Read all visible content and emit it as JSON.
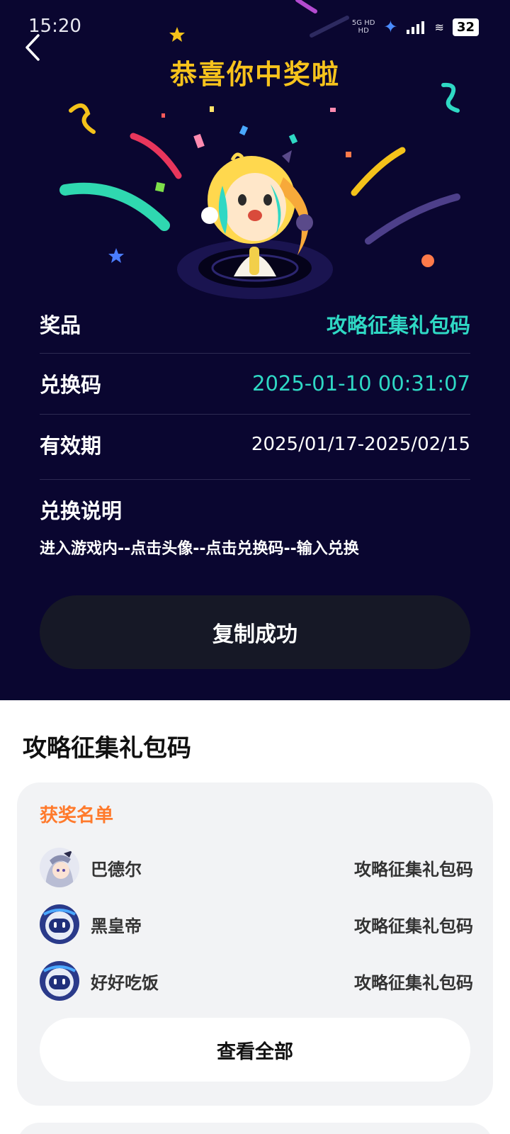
{
  "status_bar": {
    "time": "15:20",
    "network_line1": "5G HD",
    "network_line2": "HD",
    "battery": "32"
  },
  "header": {
    "title": "恭喜你中奖啦"
  },
  "prize_info": {
    "prize_label": "奖品",
    "prize_value": "攻略征集礼包码",
    "code_label": "兑换码",
    "code_value": "2025-01-10 00:31:07",
    "validity_label": "有效期",
    "validity_value": "2025/01/17-2025/02/15",
    "instructions_label": "兑换说明",
    "instructions_text": "进入游戏内--点击头像--点击兑换码--输入兑换"
  },
  "copy_button": {
    "label": "复制成功"
  },
  "section": {
    "title": "攻略征集礼包码"
  },
  "winners": {
    "heading": "获奖名单",
    "items": [
      {
        "name": "巴德尔",
        "prize": "攻略征集礼包码"
      },
      {
        "name": "黑皇帝",
        "prize": "攻略征集礼包码"
      },
      {
        "name": "好好吃饭",
        "prize": "攻略征集礼包码"
      }
    ],
    "view_all_label": "查看全部"
  },
  "colors": {
    "background_dark": "#0a0630",
    "title_yellow": "#f7c31c",
    "accent_teal": "#2fd8c4",
    "winners_orange": "#ff7a2c",
    "button_dark": "#161826",
    "card_gray": "#f2f3f5"
  }
}
